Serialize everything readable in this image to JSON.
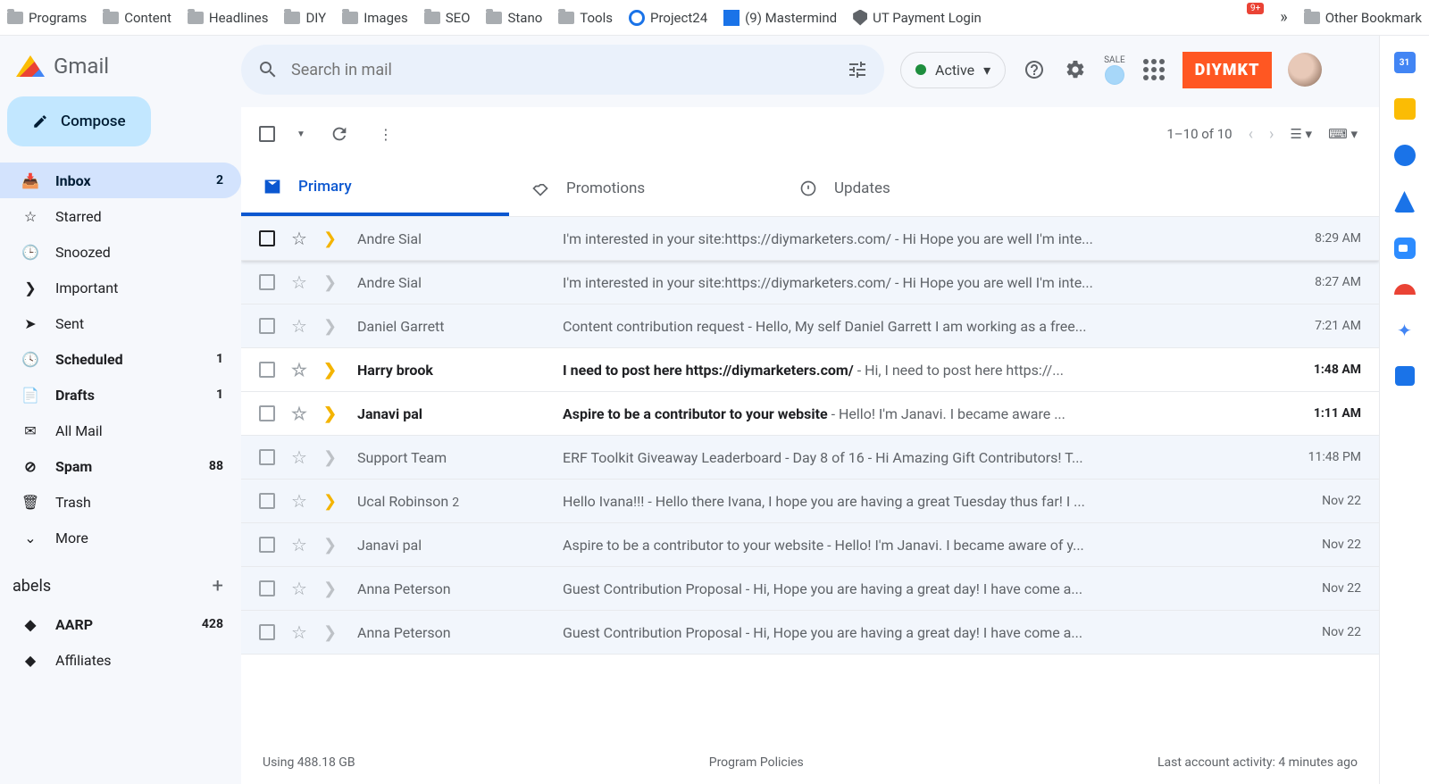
{
  "bookmarks": {
    "items": [
      "Programs",
      "Content",
      "Headlines",
      "DIY",
      "Images",
      "SEO",
      "Stano",
      "Tools"
    ],
    "special": [
      {
        "name": "Project24",
        "icon": "target"
      },
      {
        "name": "(9) Mastermind",
        "icon": "blue"
      },
      {
        "name": "UT Payment Login",
        "icon": "shield"
      }
    ],
    "notif": "9+",
    "other": "Other Bookmark"
  },
  "brand": "Gmail",
  "compose": "Compose",
  "search_placeholder": "Search in mail",
  "status": "Active",
  "diymkt": "DIYMKT",
  "nav": [
    {
      "label": "Inbox",
      "count": "2",
      "active": true
    },
    {
      "label": "Starred"
    },
    {
      "label": "Snoozed"
    },
    {
      "label": "Important"
    },
    {
      "label": "Sent"
    },
    {
      "label": "Scheduled",
      "count": "1",
      "bold": true
    },
    {
      "label": "Drafts",
      "count": "1",
      "bold": true
    },
    {
      "label": "All Mail"
    },
    {
      "label": "Spam",
      "count": "88",
      "bold": true
    },
    {
      "label": "Trash"
    },
    {
      "label": "More"
    }
  ],
  "labels_head": "abels",
  "labels": [
    {
      "label": "AARP",
      "count": "428",
      "bold": true
    },
    {
      "label": "Affiliates"
    }
  ],
  "pager": "1–10 of 10",
  "tabs": [
    {
      "label": "Primary",
      "active": true
    },
    {
      "label": "Promotions"
    },
    {
      "label": "Updates"
    }
  ],
  "emails": [
    {
      "sender": "Andre Sial",
      "subject": "I'm interested in your site:https://diymarketers.com/",
      "snippet": " - Hi Hope you are well I'm inte...",
      "date": "8:29 AM",
      "unread": false,
      "imp": "yellow",
      "first": true
    },
    {
      "sender": "Andre Sial",
      "subject": "I'm interested in your site:https://diymarketers.com/",
      "snippet": " - Hi Hope you are well I'm inte...",
      "date": "8:27 AM",
      "unread": false,
      "imp": "gray"
    },
    {
      "sender": "Daniel Garrett",
      "subject": "Content contribution request",
      "snippet": " - Hello, My self Daniel Garrett I am working as a free...",
      "date": "7:21 AM",
      "unread": false,
      "imp": "gray"
    },
    {
      "sender": "Harry brook",
      "subject": "I need to post here https://diymarketers.com/",
      "snippet": " - Hi, I need to post here https://...",
      "date": "1:48 AM",
      "unread": true,
      "imp": "yellow"
    },
    {
      "sender": "Janavi pal",
      "subject": "Aspire to be a contributor to your website",
      "snippet": " - Hello! I'm Janavi. I became aware ...",
      "date": "1:11 AM",
      "unread": true,
      "imp": "yellow"
    },
    {
      "sender": "Support Team",
      "subject": "ERF Toolkit Giveaway Leaderboard - Day 8 of 16",
      "snippet": " - Hi Amazing Gift Contributors! T...",
      "date": "11:48 PM",
      "unread": false,
      "imp": "gray"
    },
    {
      "sender": "Ucal Robinson",
      "thread": "2",
      "subject": "Hello Ivana!!!",
      "snippet": " - Hello there Ivana, I hope you are having a great Tuesday thus far! I ...",
      "date": "Nov 22",
      "unread": false,
      "imp": "yellow"
    },
    {
      "sender": "Janavi pal",
      "subject": "Aspire to be a contributor to your website",
      "snippet": " - Hello! I'm Janavi. I became aware of y...",
      "date": "Nov 22",
      "unread": false,
      "imp": "gray"
    },
    {
      "sender": "Anna Peterson",
      "subject": "Guest Contribution Proposal",
      "snippet": " - Hi, Hope you are having a great day! I have come a...",
      "date": "Nov 22",
      "unread": false,
      "imp": "gray"
    },
    {
      "sender": "Anna Peterson",
      "subject": "Guest Contribution Proposal",
      "snippet": " - Hi, Hope you are having a great day! I have come a...",
      "date": "Nov 22",
      "unread": false,
      "imp": "gray"
    }
  ],
  "footer": {
    "storage": "Using 488.18 GB",
    "policies": "Program Policies",
    "activity": "Last account activity: 4 minutes ago"
  },
  "sale": "SALE"
}
